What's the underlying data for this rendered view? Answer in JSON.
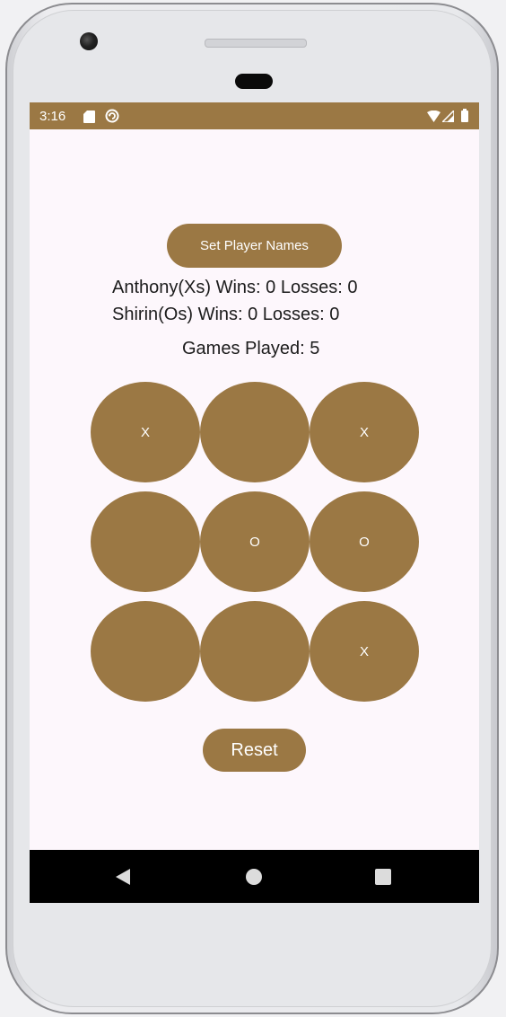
{
  "status_bar": {
    "time": "3:16",
    "left_icons": [
      "sd-card-icon",
      "sync-icon"
    ],
    "right_icons": [
      "wifi-icon",
      "signal-icon",
      "battery-icon"
    ],
    "background_color": "#9b7844"
  },
  "app": {
    "set_names_label": "Set Player Names",
    "stats": {
      "player_x": "Anthony(Xs) Wins: 0 Losses: 0",
      "player_o": "Shirin(Os) Wins: 0 Losses: 0",
      "games_played": "Games Played: 5"
    },
    "board": [
      [
        "X",
        "",
        "X"
      ],
      [
        "",
        "O",
        "O"
      ],
      [
        "",
        "",
        "X"
      ]
    ],
    "reset_label": "Reset",
    "accent_color": "#9b7844",
    "background_color": "#fdf7fc"
  },
  "nav_bar": {
    "buttons": [
      "back-icon",
      "home-icon",
      "recents-icon"
    ]
  }
}
